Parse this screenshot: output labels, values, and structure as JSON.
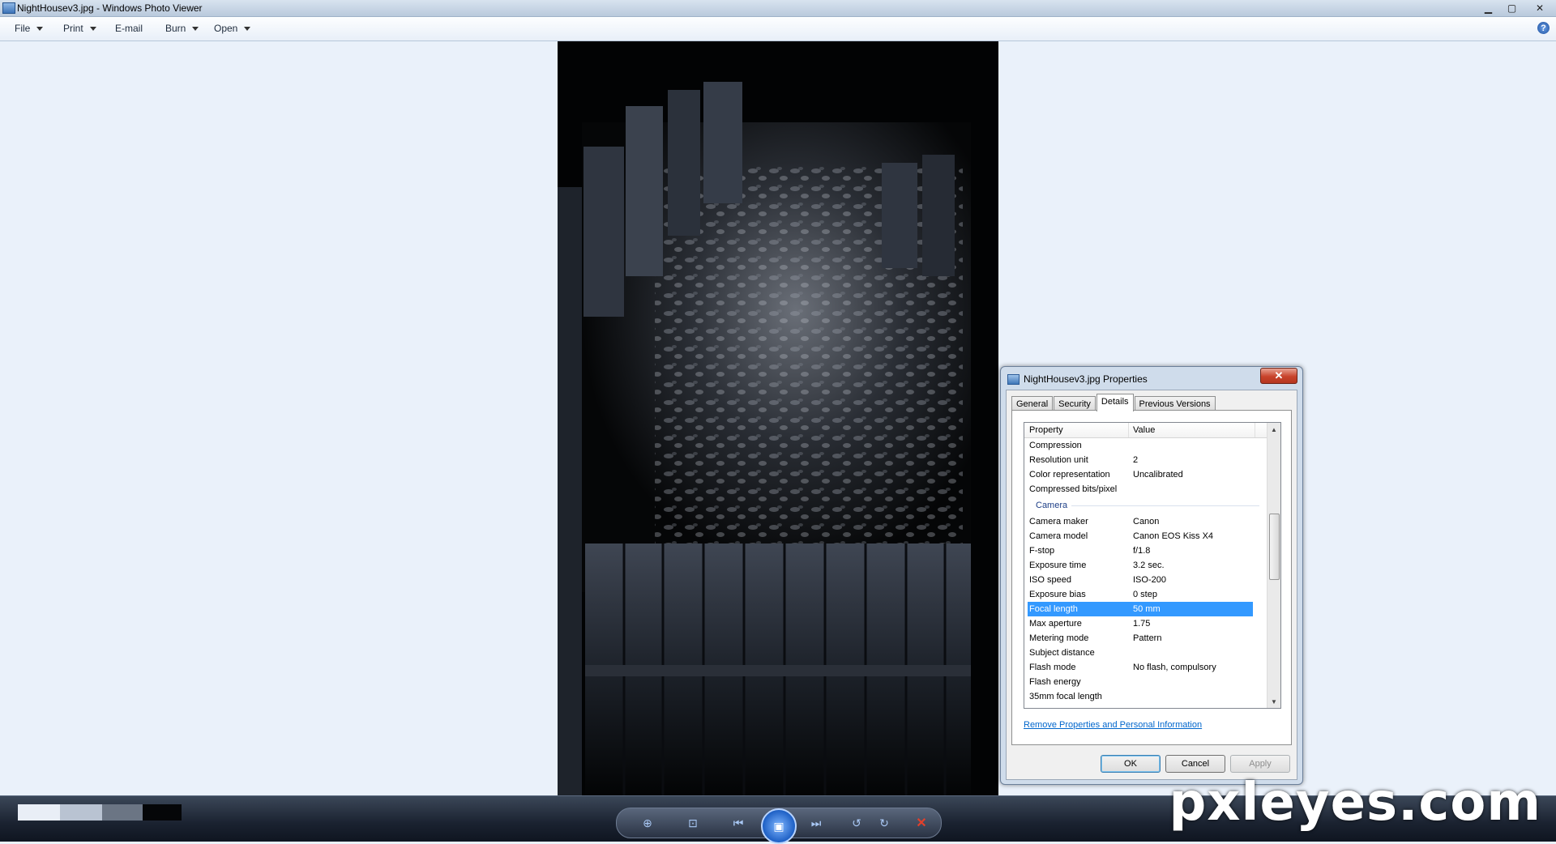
{
  "window": {
    "title": "NightHousev3.jpg - Windows Photo Viewer",
    "minimize_glyph": "▁",
    "maximize_glyph": "▢",
    "close_glyph": "✕"
  },
  "menu": {
    "items": [
      {
        "label": "File",
        "has_dropdown": true
      },
      {
        "label": "Print",
        "has_dropdown": true
      },
      {
        "label": "E-mail",
        "has_dropdown": false
      },
      {
        "label": "Burn",
        "has_dropdown": true
      },
      {
        "label": "Open",
        "has_dropdown": true
      }
    ],
    "help_glyph": "?"
  },
  "dialog": {
    "title": "NightHousev3.jpg Properties",
    "close_glyph": "✕",
    "tabs": [
      {
        "label": "General",
        "active": false
      },
      {
        "label": "Security",
        "active": false
      },
      {
        "label": "Details",
        "active": true
      },
      {
        "label": "Previous Versions",
        "active": false
      }
    ],
    "list": {
      "header_property": "Property",
      "header_value": "Value",
      "rows_top": [
        {
          "property": "Compression",
          "value": ""
        },
        {
          "property": "Resolution unit",
          "value": "2"
        },
        {
          "property": "Color representation",
          "value": "Uncalibrated"
        },
        {
          "property": "Compressed bits/pixel",
          "value": ""
        }
      ],
      "group_label": "Camera",
      "rows_camera": [
        {
          "property": "Camera maker",
          "value": "Canon"
        },
        {
          "property": "Camera model",
          "value": "Canon EOS Kiss X4"
        },
        {
          "property": "F-stop",
          "value": "f/1.8"
        },
        {
          "property": "Exposure time",
          "value": "3.2 sec."
        },
        {
          "property": "ISO speed",
          "value": "ISO-200"
        },
        {
          "property": "Exposure bias",
          "value": "0 step"
        },
        {
          "property": "Focal length",
          "value": "50 mm",
          "selected": true
        },
        {
          "property": "Max aperture",
          "value": "1.75"
        },
        {
          "property": "Metering mode",
          "value": "Pattern"
        },
        {
          "property": "Subject distance",
          "value": ""
        },
        {
          "property": "Flash mode",
          "value": "No flash, compulsory"
        },
        {
          "property": "Flash energy",
          "value": ""
        },
        {
          "property": "35mm focal length",
          "value": ""
        }
      ],
      "scroll_up_glyph": "▲",
      "scroll_down_glyph": "▼"
    },
    "remove_link": "Remove Properties and Personal Information",
    "buttons": {
      "ok": "OK",
      "cancel": "Cancel",
      "apply": "Apply"
    }
  },
  "controls": {
    "zoom_glyph": "⊕",
    "actual_size_glyph": "⊡",
    "previous_glyph": "⏮",
    "slideshow_glyph": "▣",
    "next_glyph": "⏭",
    "rotate_ccw_glyph": "↺",
    "rotate_cw_glyph": "↻",
    "delete_glyph": "✕"
  },
  "watermark": "pxleyes.com",
  "colors": {
    "selection": "#3399ff",
    "link": "#0066cc",
    "delete": "#e2402c"
  }
}
